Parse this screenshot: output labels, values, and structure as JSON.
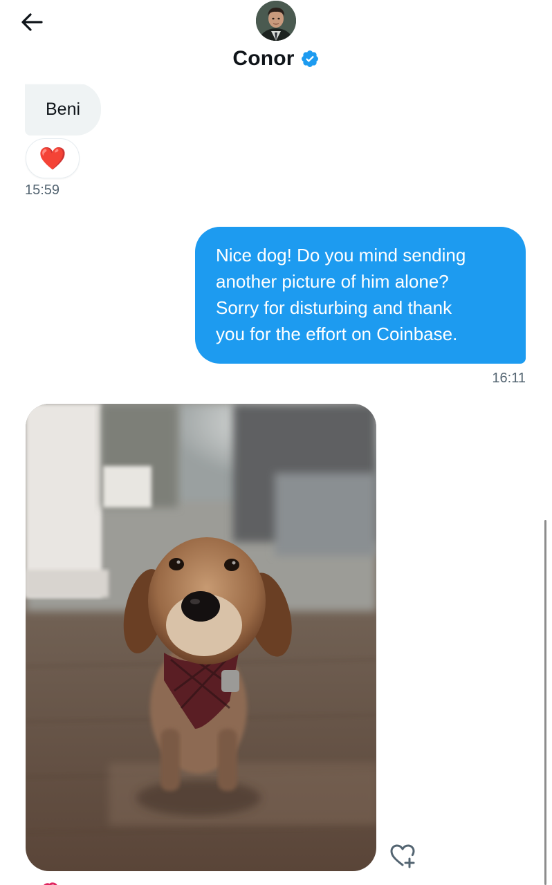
{
  "header": {
    "contact_name": "Conor",
    "verified": true,
    "avatar_icon": "profile-photo-icon"
  },
  "messages": [
    {
      "direction": "received",
      "text": "Beni",
      "reaction": "❤️",
      "time": "15:59"
    },
    {
      "direction": "sent",
      "lines": [
        "Nice dog! Do you mind sending",
        "another picture of him alone?",
        "Sorry for disturbing and thank",
        "you for the effort on Coinbase."
      ],
      "time": "16:11"
    },
    {
      "direction": "received",
      "type": "image",
      "image_subject": "dog-photo",
      "reaction_icon": "heart-plus-icon"
    }
  ],
  "colors": {
    "sent_bubble": "#1d9bf0",
    "received_bubble": "#eff3f4",
    "verified_badge": "#1d9bf0",
    "timestamp_text": "#536471"
  }
}
